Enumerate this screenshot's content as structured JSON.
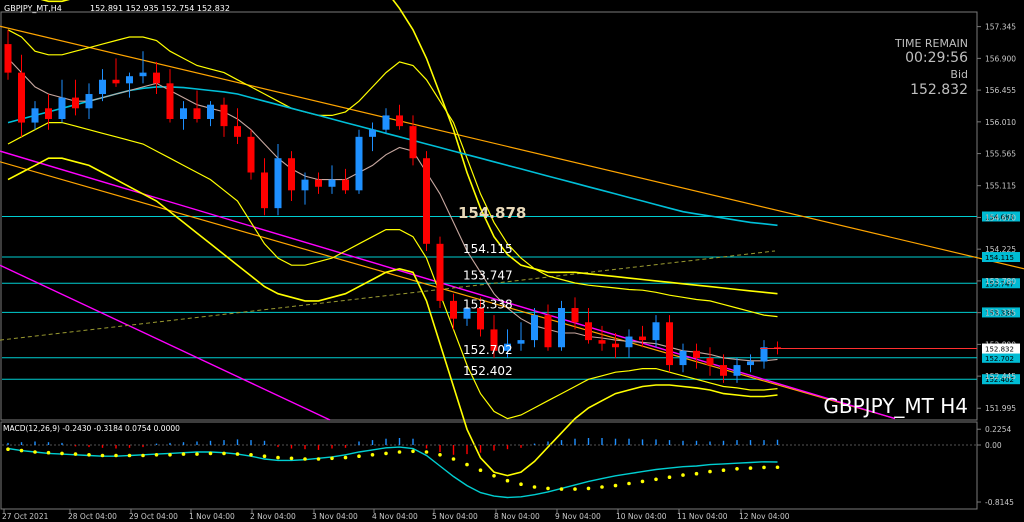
{
  "header": {
    "symbol_info": "GBPJPY_MT,H4",
    "ohlc": "152.891 152.935 152.754 152.832"
  },
  "time_remain": {
    "label": "TIME REMAIN",
    "value": "00:29:56"
  },
  "bid": {
    "label": "Bid",
    "value": "152.832"
  },
  "watermark": "GBPJPY_MT H4",
  "macd_label": "MACD(12,26,9) -0.2430 -0.3184 0.0754 0.0000",
  "colors": {
    "background": "#000000",
    "bull": "#1e90ff",
    "bear": "#ff0000",
    "level_line": "#00ced1",
    "band": "#ffff00",
    "ma_cyan": "#00bfd8",
    "ma_white": "#c8a8a0",
    "trend_orange": "#ffa500",
    "trend_magenta": "#ff00ff",
    "macd_signal": "#ffff00",
    "macd_line": "#00ced1"
  },
  "chart_data": [
    {
      "type": "candlestick",
      "title": "GBPJPY_MT,H4",
      "ylim": [
        151.83,
        157.55
      ],
      "y_ticks": [
        "157.345",
        "156.900",
        "156.455",
        "156.010",
        "155.565",
        "155.115",
        "154.670",
        "154.225",
        "153.780",
        "153.335",
        "152.890",
        "152.445",
        "151.995"
      ],
      "x_ticks": [
        "27 Oct 2021",
        "28 Oct 04:00",
        "29 Oct 04:00",
        "1 Nov 04:00",
        "2 Nov 04:00",
        "3 Nov 04:00",
        "4 Nov 04:00",
        "5 Nov 04:00",
        "8 Nov 04:00",
        "9 Nov 04:00",
        "10 Nov 04:00",
        "11 Nov 04:00",
        "12 Nov 04:00"
      ],
      "levels": [
        {
          "value": 154.683,
          "label": "154.683",
          "tag": "154.683"
        },
        {
          "value": 154.115,
          "label": "154.115",
          "tag": "154.115"
        },
        {
          "value": 153.747,
          "label": "153.747",
          "tag": "153.747"
        },
        {
          "value": 153.338,
          "label": "153.338",
          "tag": "153.338"
        },
        {
          "value": 152.702,
          "label": "152.702",
          "tag": "152.702"
        },
        {
          "value": 152.402,
          "label": "152.402",
          "tag": "152.402"
        }
      ],
      "overlap_label": "154.878",
      "current_price": {
        "value": 152.832,
        "tag": "152.832"
      },
      "candles": [
        {
          "o": 157.1,
          "h": 157.3,
          "l": 156.6,
          "c": 156.7
        },
        {
          "o": 156.7,
          "h": 156.95,
          "l": 155.8,
          "c": 156.0
        },
        {
          "o": 156.0,
          "h": 156.3,
          "l": 155.9,
          "c": 156.2
        },
        {
          "o": 156.2,
          "h": 156.4,
          "l": 155.9,
          "c": 156.05
        },
        {
          "o": 156.05,
          "h": 156.6,
          "l": 156.0,
          "c": 156.35
        },
        {
          "o": 156.35,
          "h": 156.6,
          "l": 156.1,
          "c": 156.2
        },
        {
          "o": 156.2,
          "h": 156.55,
          "l": 156.05,
          "c": 156.4
        },
        {
          "o": 156.4,
          "h": 156.75,
          "l": 156.3,
          "c": 156.6
        },
        {
          "o": 156.6,
          "h": 156.9,
          "l": 156.5,
          "c": 156.55
        },
        {
          "o": 156.55,
          "h": 156.7,
          "l": 156.35,
          "c": 156.65
        },
        {
          "o": 156.65,
          "h": 157.0,
          "l": 156.55,
          "c": 156.7
        },
        {
          "o": 156.7,
          "h": 156.85,
          "l": 156.4,
          "c": 156.55
        },
        {
          "o": 156.55,
          "h": 156.75,
          "l": 156.0,
          "c": 156.05
        },
        {
          "o": 156.05,
          "h": 156.3,
          "l": 155.9,
          "c": 156.2
        },
        {
          "o": 156.2,
          "h": 156.45,
          "l": 156.0,
          "c": 156.05
        },
        {
          "o": 156.05,
          "h": 156.3,
          "l": 155.95,
          "c": 156.25
        },
        {
          "o": 156.25,
          "h": 156.35,
          "l": 155.8,
          "c": 155.95
        },
        {
          "o": 155.95,
          "h": 156.2,
          "l": 155.7,
          "c": 155.8
        },
        {
          "o": 155.8,
          "h": 155.9,
          "l": 155.2,
          "c": 155.3
        },
        {
          "o": 155.3,
          "h": 155.5,
          "l": 154.7,
          "c": 154.8
        },
        {
          "o": 154.8,
          "h": 155.7,
          "l": 154.7,
          "c": 155.5
        },
        {
          "o": 155.5,
          "h": 155.6,
          "l": 154.9,
          "c": 155.05
        },
        {
          "o": 155.05,
          "h": 155.3,
          "l": 154.85,
          "c": 155.2
        },
        {
          "o": 155.2,
          "h": 155.3,
          "l": 155.0,
          "c": 155.1
        },
        {
          "o": 155.1,
          "h": 155.4,
          "l": 155.0,
          "c": 155.2
        },
        {
          "o": 155.2,
          "h": 155.35,
          "l": 155.0,
          "c": 155.05
        },
        {
          "o": 155.05,
          "h": 155.9,
          "l": 155.0,
          "c": 155.8
        },
        {
          "o": 155.8,
          "h": 156.0,
          "l": 155.6,
          "c": 155.9
        },
        {
          "o": 155.9,
          "h": 156.2,
          "l": 155.85,
          "c": 156.1
        },
        {
          "o": 156.1,
          "h": 156.25,
          "l": 155.9,
          "c": 155.95
        },
        {
          "o": 155.95,
          "h": 156.1,
          "l": 155.4,
          "c": 155.5
        },
        {
          "o": 155.5,
          "h": 155.6,
          "l": 154.2,
          "c": 154.3
        },
        {
          "o": 154.3,
          "h": 154.4,
          "l": 153.4,
          "c": 153.5
        },
        {
          "o": 153.5,
          "h": 153.6,
          "l": 153.1,
          "c": 153.25
        },
        {
          "o": 153.25,
          "h": 153.5,
          "l": 153.15,
          "c": 153.4
        },
        {
          "o": 153.4,
          "h": 153.55,
          "l": 153.0,
          "c": 153.1
        },
        {
          "o": 153.1,
          "h": 153.3,
          "l": 152.7,
          "c": 152.8
        },
        {
          "o": 152.8,
          "h": 153.1,
          "l": 152.7,
          "c": 152.9
        },
        {
          "o": 152.9,
          "h": 153.2,
          "l": 152.8,
          "c": 152.95
        },
        {
          "o": 152.95,
          "h": 153.4,
          "l": 152.85,
          "c": 153.3
        },
        {
          "o": 153.3,
          "h": 153.45,
          "l": 152.8,
          "c": 152.85
        },
        {
          "o": 152.85,
          "h": 153.5,
          "l": 152.8,
          "c": 153.4
        },
        {
          "o": 153.4,
          "h": 153.55,
          "l": 153.1,
          "c": 153.2
        },
        {
          "o": 153.2,
          "h": 153.4,
          "l": 152.9,
          "c": 152.95
        },
        {
          "o": 152.95,
          "h": 153.15,
          "l": 152.8,
          "c": 152.9
        },
        {
          "o": 152.9,
          "h": 153.05,
          "l": 152.7,
          "c": 152.85
        },
        {
          "o": 152.85,
          "h": 153.1,
          "l": 152.7,
          "c": 153.0
        },
        {
          "o": 153.0,
          "h": 153.15,
          "l": 152.85,
          "c": 152.95
        },
        {
          "o": 152.95,
          "h": 153.3,
          "l": 152.85,
          "c": 153.2
        },
        {
          "o": 153.2,
          "h": 153.3,
          "l": 152.5,
          "c": 152.6
        },
        {
          "o": 152.6,
          "h": 152.9,
          "l": 152.5,
          "c": 152.8
        },
        {
          "o": 152.8,
          "h": 152.9,
          "l": 152.55,
          "c": 152.7
        },
        {
          "o": 152.7,
          "h": 152.85,
          "l": 152.45,
          "c": 152.6
        },
        {
          "o": 152.6,
          "h": 152.75,
          "l": 152.35,
          "c": 152.45
        },
        {
          "o": 152.45,
          "h": 152.7,
          "l": 152.35,
          "c": 152.6
        },
        {
          "o": 152.6,
          "h": 152.75,
          "l": 152.5,
          "c": 152.65
        },
        {
          "o": 152.65,
          "h": 152.95,
          "l": 152.55,
          "c": 152.85
        },
        {
          "o": 152.85,
          "h": 152.93,
          "l": 152.75,
          "c": 152.83
        }
      ],
      "ma_slow": [
        156.0,
        156.05,
        156.1,
        156.15,
        156.2,
        156.25,
        156.3,
        156.35,
        156.4,
        156.45,
        156.48,
        156.5,
        156.5,
        156.49,
        156.47,
        156.45,
        156.43,
        156.4,
        156.35,
        156.3,
        156.25,
        156.2,
        156.15,
        156.1,
        156.05,
        156.0,
        155.95,
        155.9,
        155.85,
        155.8,
        155.75,
        155.7,
        155.65,
        155.6,
        155.55,
        155.5,
        155.45,
        155.4,
        155.35,
        155.3,
        155.25,
        155.2,
        155.15,
        155.1,
        155.05,
        155.0,
        154.95,
        154.9,
        154.85,
        154.8,
        154.75,
        154.72,
        154.69,
        154.66,
        154.63,
        154.6,
        154.58,
        154.56
      ],
      "ma_fast": [
        156.9,
        156.7,
        156.5,
        156.4,
        156.35,
        156.3,
        156.3,
        156.35,
        156.4,
        156.45,
        156.5,
        156.55,
        156.45,
        156.35,
        156.25,
        156.2,
        156.15,
        156.05,
        155.9,
        155.7,
        155.5,
        155.35,
        155.25,
        155.2,
        155.2,
        155.2,
        155.3,
        155.4,
        155.55,
        155.65,
        155.6,
        155.3,
        155.0,
        154.6,
        154.2,
        153.9,
        153.6,
        153.4,
        153.25,
        153.15,
        153.1,
        153.05,
        153.05,
        153.0,
        152.98,
        152.95,
        152.93,
        152.92,
        152.9,
        152.85,
        152.8,
        152.78,
        152.75,
        152.7,
        152.68,
        152.66,
        152.66,
        152.68
      ],
      "band_inner_upper": [
        157.3,
        157.2,
        157.0,
        156.95,
        156.95,
        157.0,
        157.05,
        157.1,
        157.15,
        157.2,
        157.2,
        157.15,
        157.0,
        156.9,
        156.8,
        156.75,
        156.7,
        156.6,
        156.5,
        156.4,
        156.3,
        156.2,
        156.15,
        156.1,
        156.1,
        156.15,
        156.3,
        156.5,
        156.7,
        156.85,
        156.8,
        156.6,
        156.3,
        156.0,
        155.5,
        155.0,
        154.6,
        154.3,
        154.1,
        153.95,
        153.85,
        153.8,
        153.75,
        153.72,
        153.7,
        153.68,
        153.66,
        153.65,
        153.62,
        153.58,
        153.55,
        153.52,
        153.5,
        153.45,
        153.4,
        153.35,
        153.3,
        153.28
      ],
      "band_inner_lower": [
        155.7,
        155.8,
        155.9,
        156.0,
        156.0,
        155.95,
        155.9,
        155.85,
        155.8,
        155.75,
        155.7,
        155.6,
        155.5,
        155.4,
        155.3,
        155.2,
        155.05,
        154.9,
        154.6,
        154.3,
        154.1,
        154.0,
        154.0,
        154.05,
        154.1,
        154.2,
        154.3,
        154.4,
        154.5,
        154.5,
        154.4,
        154.1,
        153.6,
        153.1,
        152.6,
        152.2,
        151.95,
        151.85,
        151.9,
        152.0,
        152.1,
        152.2,
        152.3,
        152.4,
        152.45,
        152.5,
        152.52,
        152.55,
        152.55,
        152.5,
        152.45,
        152.4,
        152.35,
        152.3,
        152.28,
        152.25,
        152.25,
        152.27
      ],
      "band_outer_upper": [
        157.8,
        157.8,
        157.75,
        157.7,
        157.7,
        157.75,
        157.8,
        157.85,
        157.9,
        157.95,
        158.0,
        158.0,
        157.95,
        157.9,
        157.9,
        157.95,
        158.0,
        158.05,
        158.1,
        158.15,
        158.2,
        158.25,
        158.3,
        158.35,
        158.35,
        158.3,
        158.2,
        158.05,
        157.85,
        157.6,
        157.3,
        156.9,
        156.4,
        155.9,
        155.3,
        154.8,
        154.4,
        154.15,
        154.0,
        153.95,
        153.9,
        153.9,
        153.9,
        153.88,
        153.86,
        153.84,
        153.82,
        153.8,
        153.78,
        153.76,
        153.74,
        153.72,
        153.7,
        153.68,
        153.66,
        153.64,
        153.62,
        153.6
      ],
      "band_outer_lower": [
        155.2,
        155.3,
        155.4,
        155.5,
        155.5,
        155.45,
        155.4,
        155.3,
        155.2,
        155.1,
        155.0,
        154.9,
        154.75,
        154.6,
        154.45,
        154.3,
        154.15,
        154.0,
        153.85,
        153.7,
        153.6,
        153.55,
        153.5,
        153.5,
        153.55,
        153.6,
        153.7,
        153.8,
        153.9,
        153.95,
        153.9,
        153.5,
        152.9,
        152.3,
        151.7,
        151.3,
        151.1,
        151.05,
        151.1,
        151.25,
        151.45,
        151.65,
        151.85,
        152.0,
        152.1,
        152.2,
        152.25,
        152.3,
        152.32,
        152.32,
        152.3,
        152.28,
        152.25,
        152.2,
        152.18,
        152.16,
        152.16,
        152.18
      ]
    },
    {
      "type": "bar",
      "title": "MACD(12,26,9) -0.2430 -0.3184 0.0754 0.0000",
      "ylim": [
        -0.9,
        0.3
      ],
      "y_ticks": [
        "0.2254",
        "0.00",
        "-0.8145"
      ],
      "histogram": [
        0.03,
        0.04,
        0.05,
        0.04,
        0.03,
        -0.02,
        -0.03,
        -0.04,
        -0.05,
        -0.04,
        -0.03,
        0.02,
        0.03,
        0.04,
        0.05,
        0.06,
        0.07,
        0.08,
        0.07,
        0.06,
        -0.03,
        -0.05,
        -0.06,
        -0.07,
        -0.05,
        -0.04,
        0.05,
        0.07,
        0.09,
        0.1,
        0.09,
        -0.05,
        -0.1,
        -0.14,
        -0.13,
        -0.11,
        -0.08,
        -0.06,
        -0.04,
        0.02,
        0.05,
        0.07,
        0.09,
        0.1,
        0.1,
        0.09,
        0.09,
        0.08,
        0.08,
        0.07,
        0.06,
        0.06,
        0.05,
        0.06,
        0.07,
        0.07,
        0.07,
        0.075
      ],
      "macd_line": [
        -0.05,
        -0.08,
        -0.1,
        -0.12,
        -0.13,
        -0.14,
        -0.15,
        -0.16,
        -0.16,
        -0.15,
        -0.14,
        -0.13,
        -0.12,
        -0.11,
        -0.1,
        -0.1,
        -0.11,
        -0.13,
        -0.16,
        -0.2,
        -0.22,
        -0.22,
        -0.21,
        -0.19,
        -0.17,
        -0.14,
        -0.1,
        -0.07,
        -0.04,
        -0.03,
        -0.05,
        -0.15,
        -0.3,
        -0.45,
        -0.58,
        -0.68,
        -0.73,
        -0.75,
        -0.74,
        -0.71,
        -0.67,
        -0.62,
        -0.57,
        -0.52,
        -0.48,
        -0.44,
        -0.41,
        -0.38,
        -0.35,
        -0.33,
        -0.31,
        -0.3,
        -0.28,
        -0.27,
        -0.26,
        -0.25,
        -0.24,
        -0.243
      ],
      "signal_line": [
        -0.06,
        -0.08,
        -0.1,
        -0.11,
        -0.12,
        -0.13,
        -0.14,
        -0.15,
        -0.15,
        -0.15,
        -0.15,
        -0.14,
        -0.14,
        -0.13,
        -0.13,
        -0.12,
        -0.12,
        -0.13,
        -0.14,
        -0.16,
        -0.18,
        -0.19,
        -0.2,
        -0.2,
        -0.19,
        -0.18,
        -0.16,
        -0.14,
        -0.12,
        -0.1,
        -0.09,
        -0.1,
        -0.14,
        -0.2,
        -0.28,
        -0.36,
        -0.44,
        -0.51,
        -0.56,
        -0.6,
        -0.62,
        -0.63,
        -0.63,
        -0.62,
        -0.6,
        -0.58,
        -0.55,
        -0.52,
        -0.49,
        -0.46,
        -0.43,
        -0.41,
        -0.38,
        -0.36,
        -0.34,
        -0.33,
        -0.32,
        -0.318
      ]
    }
  ]
}
